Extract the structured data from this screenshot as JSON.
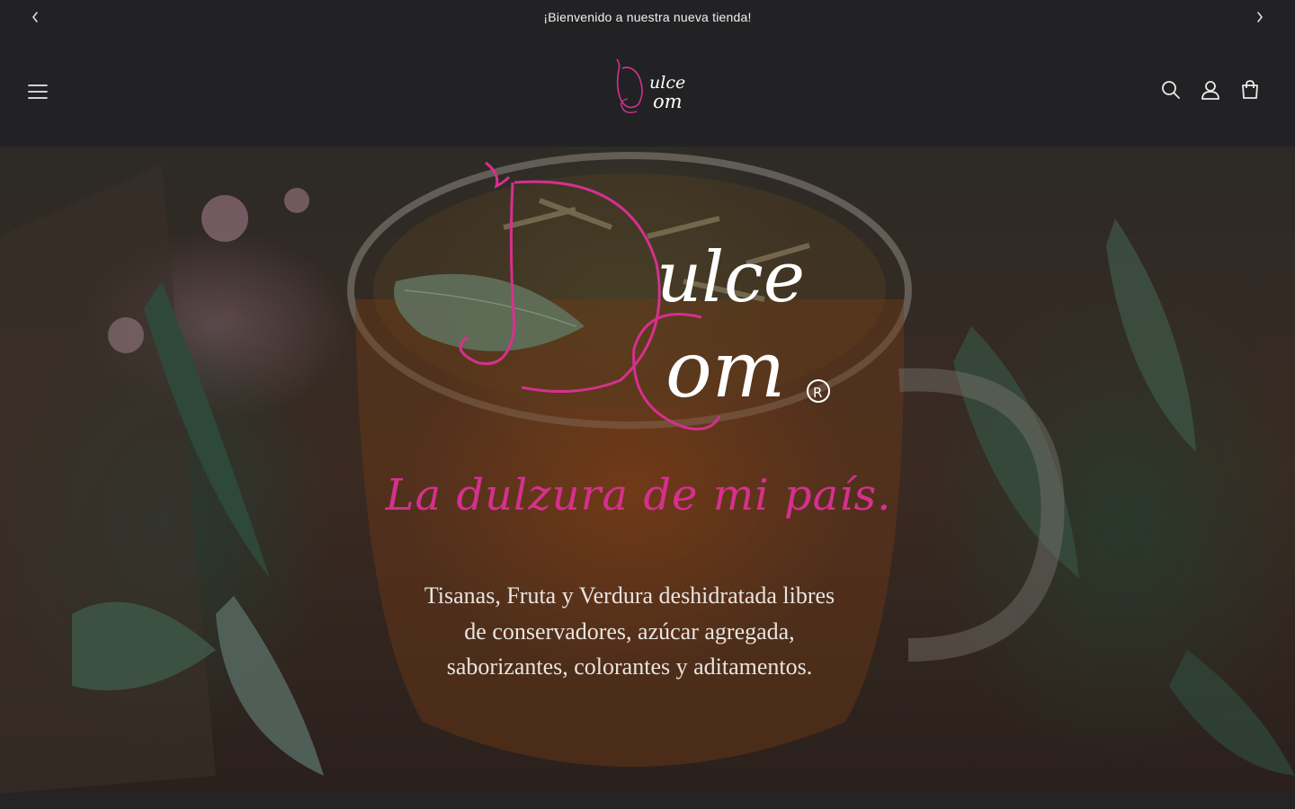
{
  "announcement": {
    "text": "¡Bienvenido a nuestra nueva tienda!",
    "prev_icon": "chevron-left-icon",
    "next_icon": "chevron-right-icon"
  },
  "header": {
    "menu_icon": "hamburger-menu-icon",
    "logo": {
      "line1": "ulce",
      "line2": "om",
      "initials": "D C"
    },
    "icons": [
      "search-icon",
      "account-icon",
      "cart-icon"
    ]
  },
  "hero": {
    "logo": {
      "line1": "ulce",
      "line2": "om",
      "mark": "R"
    },
    "tagline": "La dulzura de mi país.",
    "description": "Tisanas, Fruta y Verdura deshidratada libres de conservadores, azúcar agregada, saborizantes, colorantes y aditamentos."
  },
  "colors": {
    "background": "#222224",
    "accent_pink": "#d6308f",
    "text": "#ffffff"
  }
}
